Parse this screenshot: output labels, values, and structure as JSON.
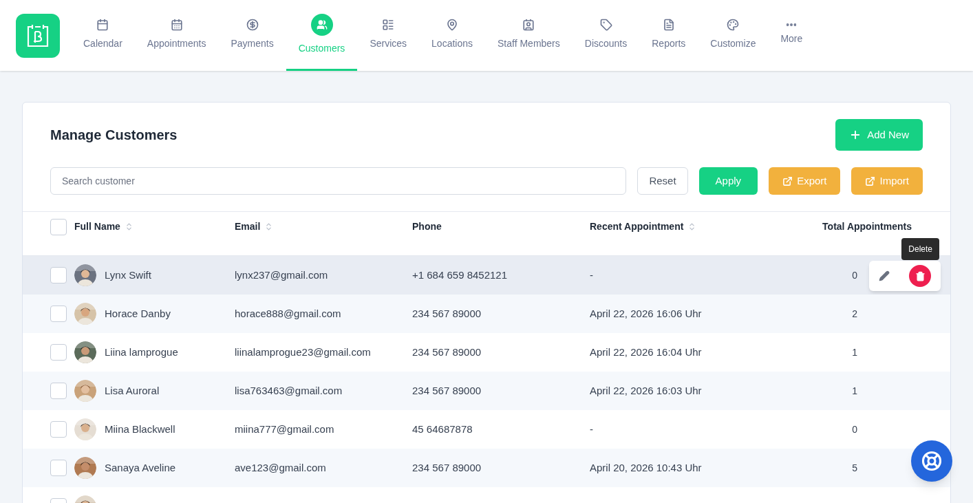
{
  "nav": {
    "items": [
      {
        "label": "Calendar",
        "selected": false
      },
      {
        "label": "Appointments",
        "selected": false
      },
      {
        "label": "Payments",
        "selected": false
      },
      {
        "label": "Customers",
        "selected": true
      },
      {
        "label": "Services",
        "selected": false
      },
      {
        "label": "Locations",
        "selected": false
      },
      {
        "label": "Staff Members",
        "selected": false
      },
      {
        "label": "Discounts",
        "selected": false
      },
      {
        "label": "Reports",
        "selected": false
      },
      {
        "label": "Customize",
        "selected": false
      },
      {
        "label": "More",
        "selected": false
      }
    ]
  },
  "panel": {
    "title": "Manage Customers",
    "add_button": "Add New",
    "search": {
      "placeholder": "Search customer"
    },
    "buttons": [
      {
        "label": "Reset",
        "kind": "outline"
      },
      {
        "label": "Apply",
        "kind": "primary"
      },
      {
        "label": "Export",
        "kind": "warning"
      },
      {
        "label": "Import",
        "kind": "warning"
      }
    ],
    "table": {
      "select_all_checked": false,
      "columns": [
        {
          "label": "Full Name",
          "sortable": true
        },
        {
          "label": "Email",
          "sortable": true
        },
        {
          "label": "Phone",
          "sortable": false
        },
        {
          "label": "Recent Appointment",
          "sortable": true
        },
        {
          "label": "Total Appointments",
          "sortable": false
        }
      ],
      "rows": [
        {
          "name": "Lynx Swift",
          "email": "lynx237@gmail.com",
          "phone": "+1 684 659 8452121",
          "recent": "-",
          "total": "0",
          "checked": false,
          "hovered": true,
          "tooltip": "Delete"
        },
        {
          "name": "Horace Danby",
          "email": "horace888@gmail.com",
          "phone": "234 567 89000",
          "recent": "April 22, 2026 16:06 Uhr",
          "total": "2",
          "checked": false,
          "hovered": false
        },
        {
          "name": "Liina lamprogue",
          "email": "liinalamprogue23@gmail.com",
          "phone": "234 567 89000",
          "recent": "April 22, 2026 16:04 Uhr",
          "total": "1",
          "checked": false,
          "hovered": false
        },
        {
          "name": "Lisa Auroral",
          "email": "lisa763463@gmail.com",
          "phone": "234 567 89000",
          "recent": "April 22, 2026 16:03 Uhr",
          "total": "1",
          "checked": false,
          "hovered": false
        },
        {
          "name": "Miina Blackwell",
          "email": "miina777@gmail.com",
          "phone": "45 64687878",
          "recent": "-",
          "total": "0",
          "checked": false,
          "hovered": false
        },
        {
          "name": "Sanaya Aveline",
          "email": "ave123@gmail.com",
          "phone": "234 567 89000",
          "recent": "April 20, 2026 10:43 Uhr",
          "total": "5",
          "checked": false,
          "hovered": false
        },
        {
          "checked": false,
          "hovered": false
        }
      ]
    }
  }
}
